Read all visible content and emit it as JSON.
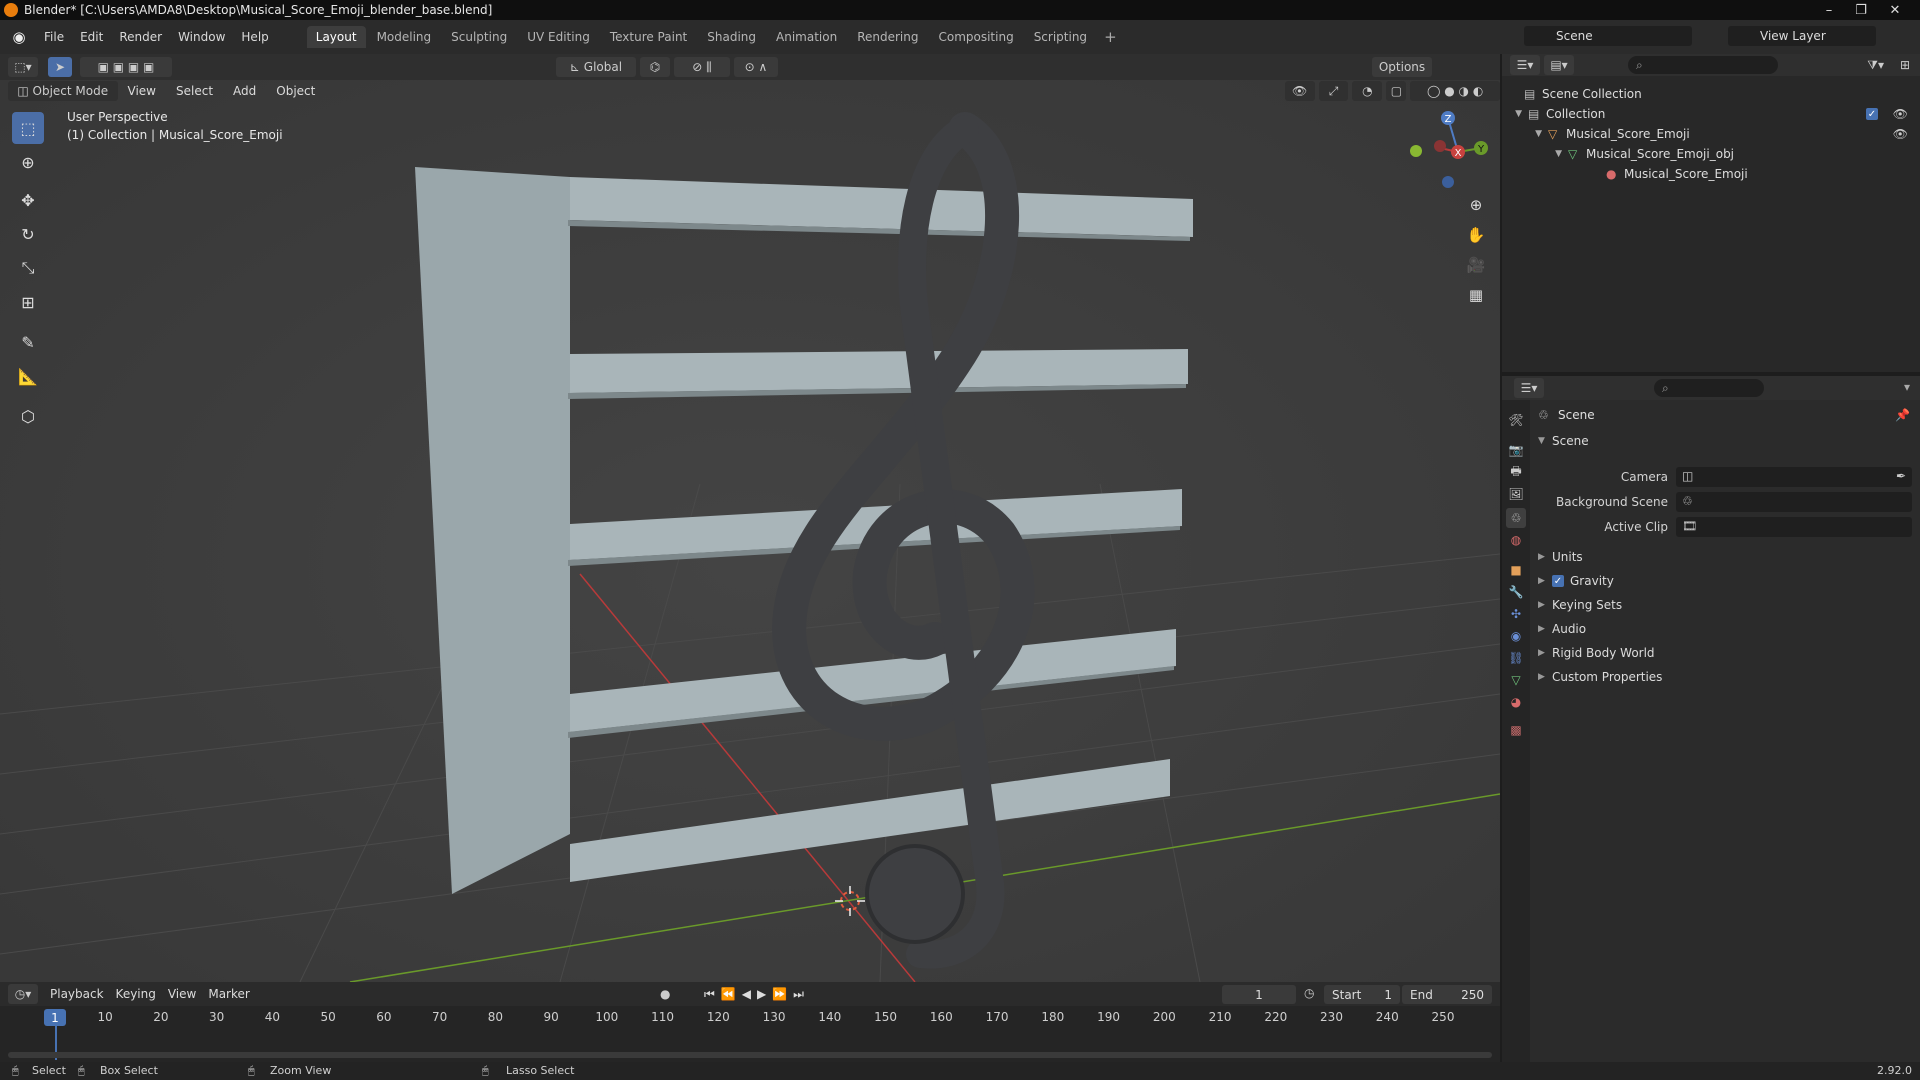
{
  "window": {
    "title": "Blender* [C:\\Users\\AMDA8\\Desktop\\Musical_Score_Emoji_blender_base.blend]",
    "minimize": "–",
    "maximize": "❐",
    "close": "✕"
  },
  "menu": [
    "File",
    "Edit",
    "Render",
    "Window",
    "Help"
  ],
  "workspaces": {
    "tabs": [
      "Layout",
      "Modeling",
      "Sculpting",
      "UV Editing",
      "Texture Paint",
      "Shading",
      "Animation",
      "Rendering",
      "Compositing",
      "Scripting"
    ],
    "active": "Layout",
    "add": "+"
  },
  "scene_field": "Scene",
  "view_layer_field": "View Layer",
  "viewport": {
    "transform_orientation": "Global",
    "options_label": "Options",
    "mode": "Object Mode",
    "menu": [
      "View",
      "Select",
      "Add",
      "Object"
    ],
    "info_line1": "User Perspective",
    "info_line2": "(1) Collection | Musical_Score_Emoji",
    "gizmo": {
      "x": "X",
      "y": "Y",
      "z": "Z"
    }
  },
  "outliner": {
    "search_placeholder": "",
    "rows": [
      {
        "label": "Scene Collection"
      },
      {
        "label": "Collection"
      },
      {
        "label": "Musical_Score_Emoji"
      },
      {
        "label": "Musical_Score_Emoji_obj"
      },
      {
        "label": "Musical_Score_Emoji"
      }
    ]
  },
  "properties": {
    "context": "Scene",
    "panel_title": "Scene",
    "camera_label": "Camera",
    "background_scene_label": "Background Scene",
    "active_clip_label": "Active Clip",
    "panels": [
      "Units",
      "Gravity",
      "Keying Sets",
      "Audio",
      "Rigid Body World",
      "Custom Properties"
    ],
    "gravity_checked": true
  },
  "timeline": {
    "menu": [
      "Playback",
      "Keying",
      "View",
      "Marker"
    ],
    "current_frame": "1",
    "start_label": "Start",
    "start": "1",
    "end_label": "End",
    "end": "250",
    "ticks": [
      "10",
      "20",
      "30",
      "40",
      "50",
      "60",
      "70",
      "80",
      "90",
      "100",
      "110",
      "120",
      "130",
      "140",
      "150",
      "160",
      "170",
      "180",
      "190",
      "200",
      "210",
      "220",
      "230",
      "240",
      "250"
    ]
  },
  "statusbar": {
    "select": "Select",
    "box_select": "Box Select",
    "zoom_view": "Zoom View",
    "lasso_select": "Lasso Select",
    "version": "2.92.0"
  },
  "colors": {
    "accent": "#4772b3",
    "staff": "#9aa7ab",
    "clef": "#3e3f42",
    "x_axis": "#b83a3a",
    "y_axis": "#6a9a2a"
  }
}
